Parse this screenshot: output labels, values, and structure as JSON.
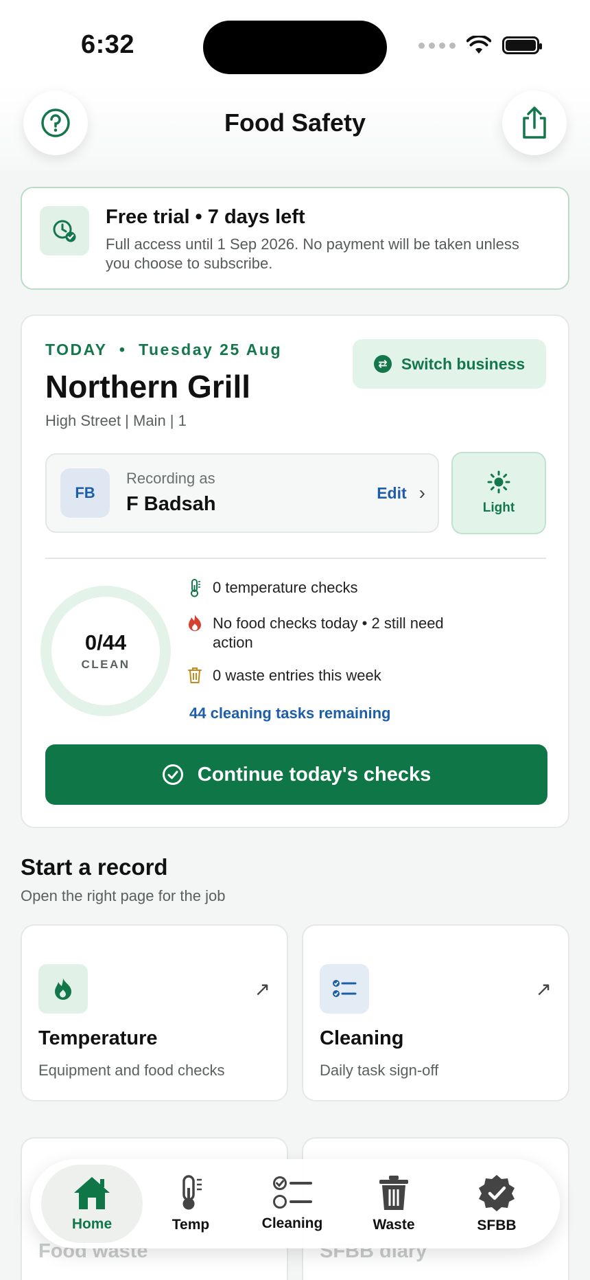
{
  "status_bar": {
    "time": "6:32"
  },
  "header": {
    "title": "Food Safety"
  },
  "trial": {
    "title": "Free trial • 7 days left",
    "description": "Full access until 1 Sep 2026. No payment will be taken unless you choose to subscribe."
  },
  "today": {
    "label": "TODAY  •  Tuesday 25 Aug",
    "business_name": "Northern Grill",
    "location": "High Street | Main | 1",
    "switch_label": "Switch business",
    "recording_label": "Recording as",
    "initials": "FB",
    "user_name": "F Badsah",
    "edit_label": "Edit",
    "theme_label": "Light",
    "progress_text": "0/44",
    "progress_caption": "CLEAN",
    "progress_fraction": 0,
    "stats": {
      "temperature": "0 temperature checks",
      "food": "No food checks today • 2 still need action",
      "waste": "0 waste entries this week",
      "cleaning_link": "44 cleaning tasks remaining"
    },
    "continue_label": "Continue today's checks"
  },
  "records": {
    "title": "Start a record",
    "subtitle": "Open the right page for the job",
    "cards": [
      {
        "title": "Temperature",
        "description": "Equipment and food checks",
        "icon": "flame-icon"
      },
      {
        "title": "Cleaning",
        "description": "Daily task sign-off",
        "icon": "checklist-icon"
      },
      {
        "title": "Food waste"
      },
      {
        "title": "SFBB diary"
      }
    ]
  },
  "tab_bar": {
    "tabs": [
      {
        "label": "Home",
        "icon": "home-icon"
      },
      {
        "label": "Temp",
        "icon": "thermometer-icon"
      },
      {
        "label": "Cleaning",
        "icon": "checklist-icon"
      },
      {
        "label": "Waste",
        "icon": "trash-icon"
      },
      {
        "label": "SFBB",
        "icon": "badge-check-icon"
      }
    ]
  },
  "colors": {
    "brand_green": "#0e7647",
    "link_blue": "#1e5ea8",
    "background": "#f4f6f5"
  }
}
